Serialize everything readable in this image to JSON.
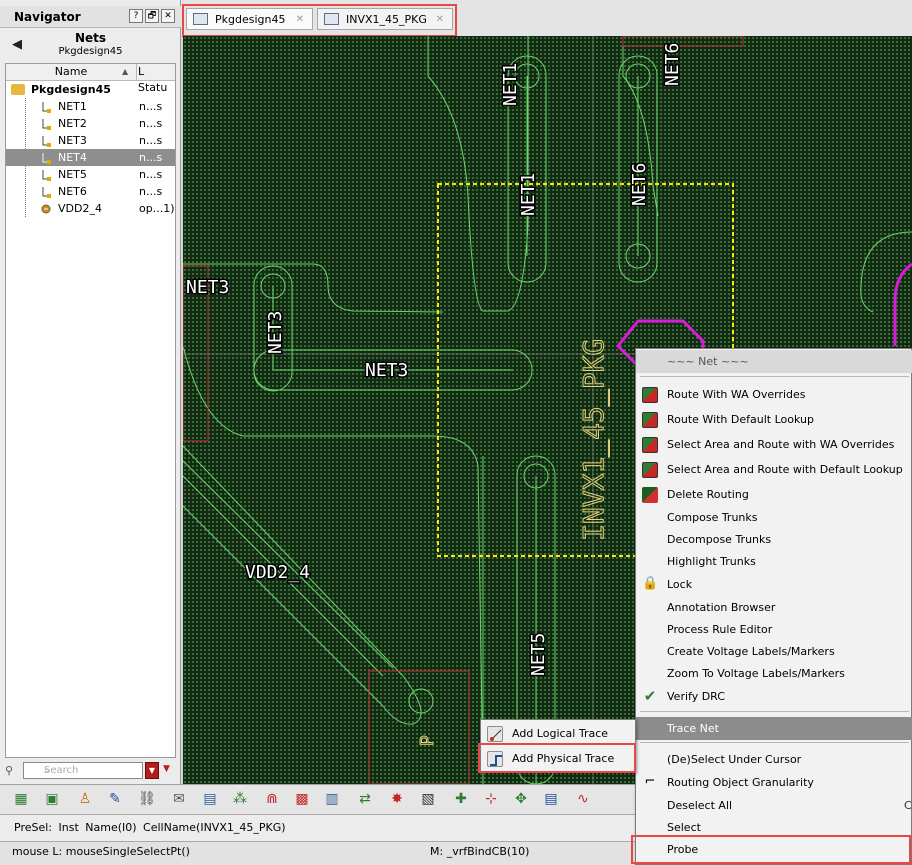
{
  "navigator": {
    "title": "Navigator",
    "help_btn": "?",
    "restore_btn": "🗗",
    "close_btn": "✕",
    "back_icon": "◀",
    "section": "Nets",
    "design": "Pkgdesign45",
    "columns": {
      "name": "Name",
      "status": "L Statu"
    },
    "root": "Pkgdesign45",
    "nets": [
      {
        "name": "NET1",
        "status": "n...s"
      },
      {
        "name": "NET2",
        "status": "n...s"
      },
      {
        "name": "NET3",
        "status": "n...s"
      },
      {
        "name": "NET4",
        "status": "n...s"
      },
      {
        "name": "NET5",
        "status": "n...s"
      },
      {
        "name": "NET6",
        "status": "n...s"
      },
      {
        "name": "VDD2_4",
        "status": "op...1)"
      }
    ],
    "selected_net": "NET4",
    "search_placeholder": "Search"
  },
  "tabs": [
    {
      "label": "Pkgdesign45",
      "active": true
    },
    {
      "label": "INVX1_45_PKG",
      "active": false
    }
  ],
  "canvas": {
    "labels": [
      "NET1",
      "NET6",
      "NET3",
      "NET3",
      "NET3",
      "NET5",
      "VDD2_4",
      "INVX1_45_PKG",
      "P"
    ]
  },
  "context_menu": {
    "header": "~~~ Net ~~~",
    "items": [
      {
        "label": "Route With WA Overrides",
        "icon": "route-icon"
      },
      {
        "label": "Route With Default Lookup",
        "icon": "route-icon"
      },
      {
        "label": "Select Area and Route with WA Overrides",
        "icon": "route-icon"
      },
      {
        "label": "Select Area and Route with Default Lookup",
        "icon": "route-icon"
      },
      {
        "label": "Delete Routing",
        "icon": "delete-routing-icon"
      },
      {
        "label": "Compose Trunks",
        "icon": ""
      },
      {
        "label": "Decompose Trunks",
        "icon": ""
      },
      {
        "label": "Highlight Trunks",
        "icon": ""
      },
      {
        "label": "Lock",
        "icon": "lock-icon"
      },
      {
        "label": "Annotation Browser",
        "icon": ""
      },
      {
        "label": "Process Rule Editor",
        "icon": ""
      },
      {
        "label": "Create Voltage Labels/Markers",
        "icon": ""
      },
      {
        "label": "Zoom To Voltage Labels/Markers",
        "icon": ""
      },
      {
        "label": "Verify DRC",
        "icon": "check-icon"
      }
    ],
    "trace_net": "Trace Net",
    "lower_items": [
      {
        "label": "(De)Select Under Cursor",
        "shortcut": ""
      },
      {
        "label": "Routing Object Granularity",
        "shortcut": ""
      },
      {
        "label": "Deselect All",
        "shortcut": "C"
      },
      {
        "label": "Select",
        "shortcut": ""
      },
      {
        "label": "Probe",
        "shortcut": ""
      }
    ]
  },
  "submenu": {
    "items": [
      "Add Logical Trace",
      "Add Physical Trace"
    ]
  },
  "status": {
    "presel": "PreSel:   Inst   Name(I0)   CellName(INVX1_45_PKG)",
    "mouse": "mouse L: mouseSingleSelectPt()",
    "bind": "M: _vrfBindCB(10)"
  },
  "colors": {
    "canvas_bg": "#122a12",
    "trace": "#6bd66b",
    "highlight": "#e64848",
    "magenta": "#d81bd8",
    "yellow": "#ffe600"
  }
}
